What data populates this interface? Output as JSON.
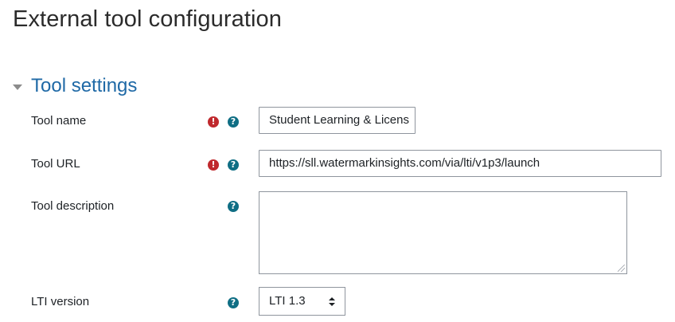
{
  "page": {
    "title": "External tool configuration"
  },
  "section": {
    "title": "Tool settings"
  },
  "fields": {
    "tool_name": {
      "label": "Tool name",
      "value": "Student Learning & Licens"
    },
    "tool_url": {
      "label": "Tool URL",
      "value": "https://sll.watermarkinsights.com/via/lti/v1p3/launch"
    },
    "tool_description": {
      "label": "Tool description",
      "value": ""
    },
    "lti_version": {
      "label": "LTI version",
      "value": "LTI 1.3"
    }
  },
  "icons": {
    "required": "exclamation-circle-icon",
    "help": "question-circle-icon"
  },
  "colors": {
    "heading_link": "#1f69a6",
    "required_icon": "#c0292d",
    "help_icon": "#0f6e84"
  }
}
